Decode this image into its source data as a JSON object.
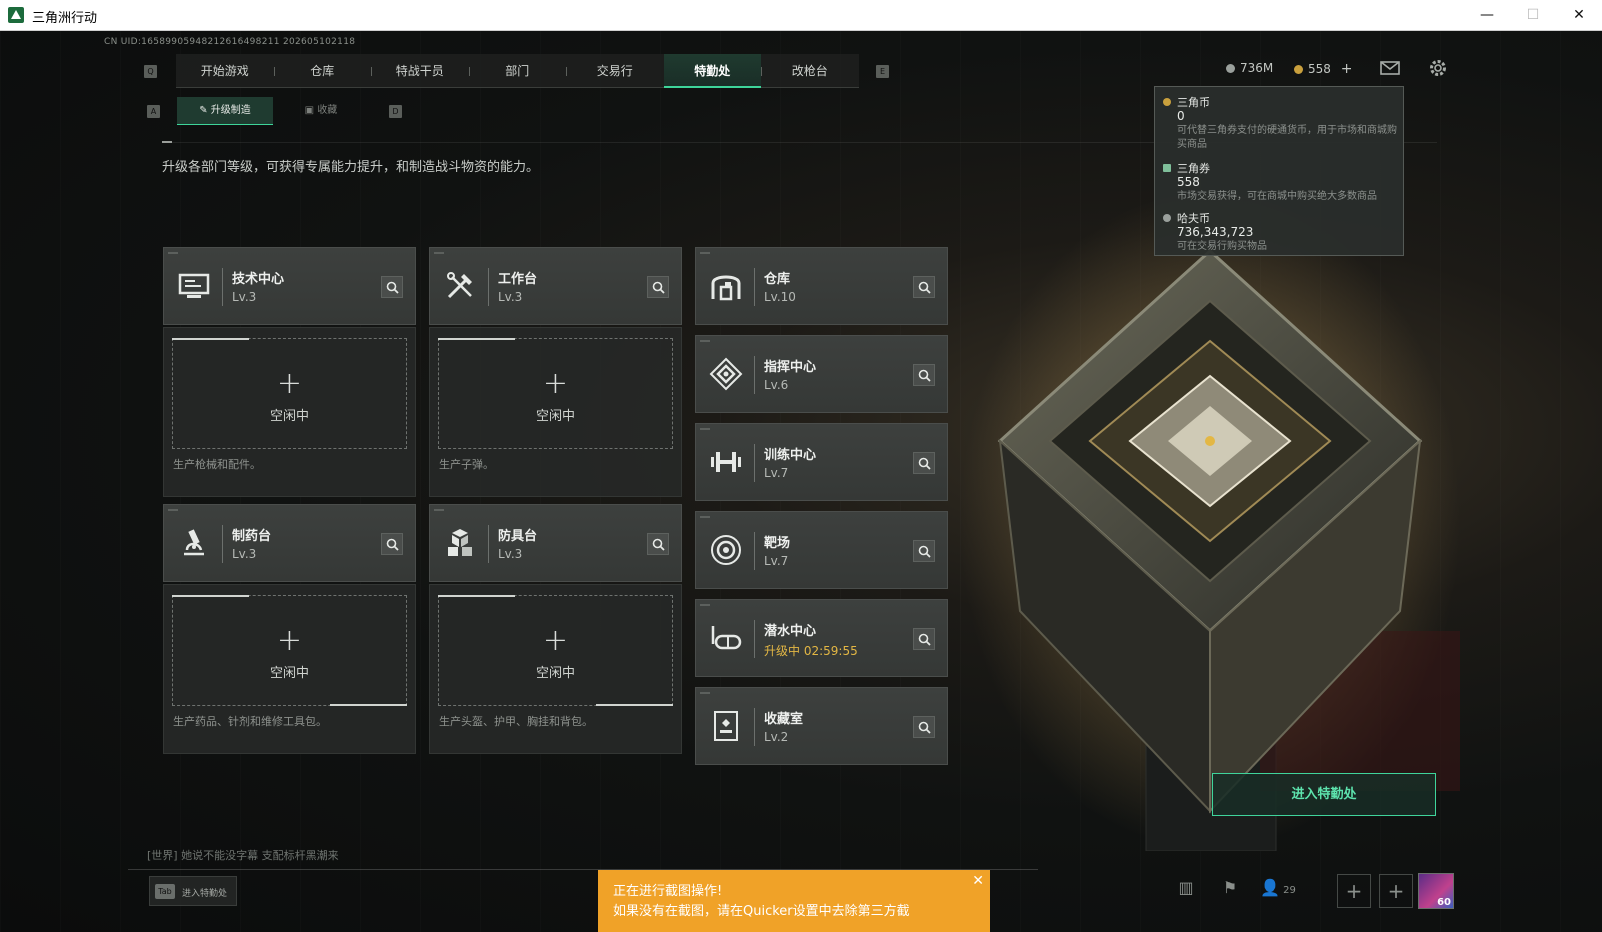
{
  "window": {
    "title": "三角洲行动",
    "minimize": "—",
    "maximize": "☐",
    "close": "✕"
  },
  "uid": "CN UID:16589905948212616498211 202605102118",
  "nav": {
    "left_key": "Q",
    "right_key": "E",
    "tabs": [
      "开始游戏",
      "仓库",
      "特战干员",
      "部门",
      "交易行",
      "特勤处",
      "改枪台"
    ],
    "active": "特勤处"
  },
  "subnav": {
    "left_key": "A",
    "right_key": "D",
    "tabs": [
      "升级制造",
      "收藏"
    ],
    "active": "升级制造"
  },
  "description": "升级各部门等级，可获得专属能力提升，和制造战斗物资的能力。",
  "departments": {
    "tech": {
      "name": "技术中心",
      "level": "Lv.3",
      "icon": "computer-icon"
    },
    "workbench": {
      "name": "工作台",
      "level": "Lv.3",
      "icon": "tools-icon"
    },
    "storage": {
      "name": "仓库",
      "level": "Lv.10",
      "icon": "warehouse-icon"
    },
    "command": {
      "name": "指挥中心",
      "level": "Lv.6",
      "icon": "command-icon"
    },
    "training": {
      "name": "训练中心",
      "level": "Lv.7",
      "icon": "dumbbell-icon"
    },
    "pharmacy": {
      "name": "制药台",
      "level": "Lv.3",
      "icon": "microscope-icon"
    },
    "armor": {
      "name": "防具台",
      "level": "Lv.3",
      "icon": "armor-icon"
    },
    "range": {
      "name": "靶场",
      "level": "Lv.7",
      "icon": "target-icon"
    },
    "diving": {
      "name": "潜水中心",
      "level": "升级中 02:59:55",
      "icon": "goggles-icon"
    },
    "collection": {
      "name": "收藏室",
      "level": "Lv.2",
      "icon": "trophy-icon"
    }
  },
  "slots": {
    "tech": {
      "plus": "+",
      "status": "空闲中",
      "desc": "生产枪械和配件。"
    },
    "workbench": {
      "plus": "+",
      "status": "空闲中",
      "desc": "生产子弹。"
    },
    "pharmacy": {
      "plus": "+",
      "status": "空闲中",
      "desc": "生产药品、针剂和维修工具包。"
    },
    "armor": {
      "plus": "+",
      "status": "空闲中",
      "desc": "生产头盔、护甲、胸挂和背包。"
    }
  },
  "currency": {
    "hafu_short": "736M",
    "ticket_short": "558",
    "ticket_add": "+",
    "tooltip": {
      "coin_title": "三角币",
      "coin_value": "0",
      "coin_desc": "可代替三角券支付的硬通货币，用于市场和商城购买商品",
      "ticket_title": "三角券",
      "ticket_value": "558",
      "ticket_desc": "市场交易获得，可在商城中购买绝大多数商品",
      "hafu_title": "哈夫币",
      "hafu_value": "736,343,723",
      "hafu_desc": "可在交易行购买物品"
    }
  },
  "enter_button": "进入特勤处",
  "chat": "[世界] 她说不能没字幕 支配标杆黑潮来",
  "tab_hint": {
    "key": "Tab",
    "label": "进入特勤处"
  },
  "toast": {
    "line1": "正在进行截图操作!",
    "line2": "如果没有在截图，请在Quicker设置中去除第三方截",
    "close": "✕"
  },
  "bottom": {
    "friends_count": "29",
    "level": "60",
    "add": "+"
  },
  "colors": {
    "accent": "#3ed59a",
    "upgrading": "#e3b744",
    "toast": "#f0a228"
  }
}
